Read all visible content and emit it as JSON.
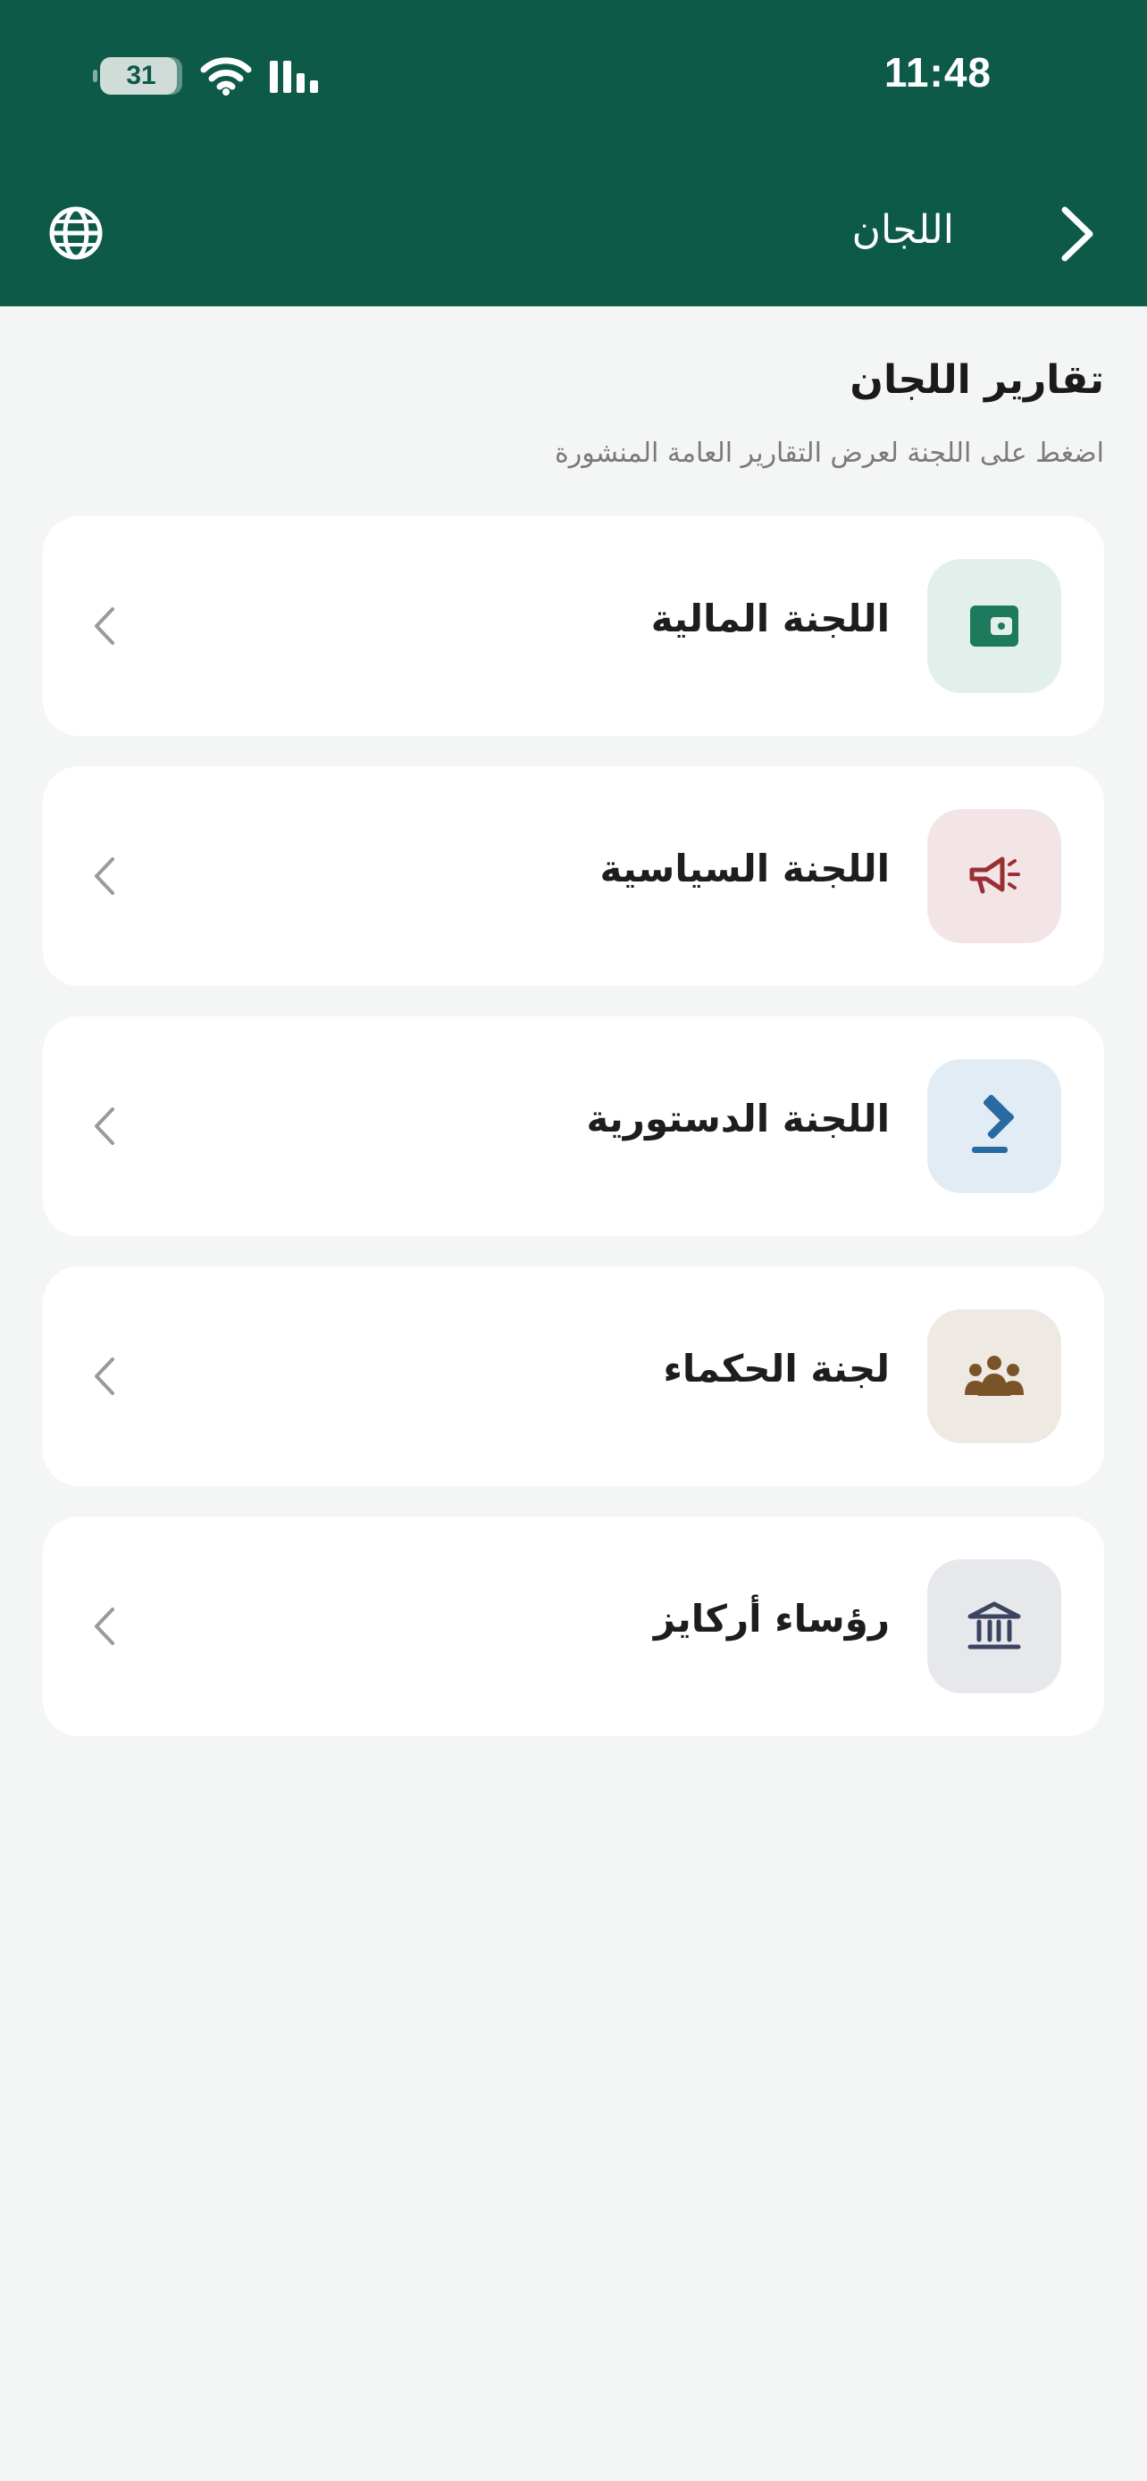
{
  "status_bar": {
    "time": "11:48",
    "battery": "31"
  },
  "nav": {
    "title": "اللجان"
  },
  "section": {
    "title": "تقارير اللجان",
    "subtitle": "اضغط على اللجنة لعرض التقارير العامة المنشورة"
  },
  "committees": [
    {
      "label": "اللجنة المالية",
      "icon": "wallet-icon",
      "icon_color": "#1d7a5c",
      "icon_bg": "#e3efea"
    },
    {
      "label": "اللجنة السياسية",
      "icon": "megaphone-icon",
      "icon_color": "#9b2f36",
      "icon_bg": "#f3e5e6"
    },
    {
      "label": "اللجنة الدستورية",
      "icon": "gavel-icon",
      "icon_color": "#2a6aa3",
      "icon_bg": "#e2ecf5"
    },
    {
      "label": "لجنة الحكماء",
      "icon": "people-group-icon",
      "icon_color": "#7a5428",
      "icon_bg": "#efe9e4"
    },
    {
      "label": "رؤساء أركايز",
      "icon": "bank-building-icon",
      "icon_color": "#3c4560",
      "icon_bg": "#e7e8ec"
    }
  ],
  "colors": {
    "header_bg": "#0d5a48",
    "page_bg": "#f4f5f5",
    "card_bg": "#ffffff"
  }
}
